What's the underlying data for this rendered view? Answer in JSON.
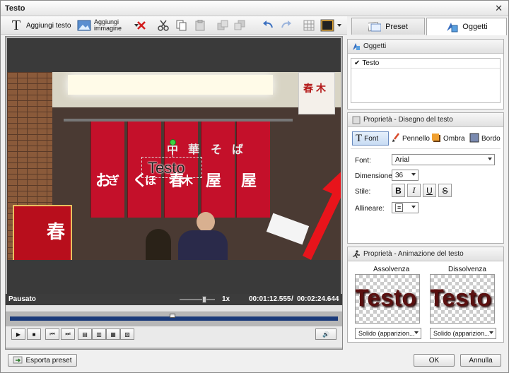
{
  "window": {
    "title": "Testo",
    "close": "✕"
  },
  "toolbar": {
    "add_text": "Aggiungi testo",
    "add_image_line1": "Aggiungi",
    "add_image_line2": "immagine"
  },
  "tabs": [
    {
      "label": "Preset"
    },
    {
      "label": "Oggetti"
    }
  ],
  "objects_panel": {
    "title": "Oggetti",
    "items": [
      "Testo"
    ]
  },
  "props_text": {
    "title": "Proprietà - Disegno del testo",
    "buttons": [
      "Font",
      "Pennello",
      "Ombra",
      "Bordo"
    ],
    "font_label": "Font:",
    "font_value": "Arial",
    "size_label": "Dimensione:",
    "size_value": "36",
    "style_label": "Stile:",
    "align_label": "Allineare:",
    "style_buttons": [
      "B",
      "I",
      "U",
      "S"
    ]
  },
  "props_anim": {
    "title": "Proprietà - Animazione del testo",
    "in_label": "Assolvenza",
    "out_label": "Dissolvenza",
    "preview_text": "Testo",
    "in_value": "Solido (apparizion...",
    "out_value": "Solido (apparizion..."
  },
  "video": {
    "overlay_text": "Testo",
    "sign_chars": [
      "お",
      "ぎ",
      "く",
      "ほ",
      "春",
      "木",
      "屋"
    ],
    "header_chars": [
      "中",
      "華",
      "そ",
      "ば"
    ],
    "side_chars": [
      "春",
      "木"
    ],
    "lantern_chars": [
      "春"
    ]
  },
  "player": {
    "status": "Pausato",
    "speed": "1x",
    "time_current": "00:01:12.555",
    "time_separator": "/",
    "time_total": "00:02:24.644"
  },
  "bottom": {
    "export": "Esporta preset",
    "ok": "OK",
    "cancel": "Annulla"
  },
  "colors": {
    "accent": "#1a56c8",
    "arrow": "#e8141b",
    "banner": "#c4102a"
  }
}
